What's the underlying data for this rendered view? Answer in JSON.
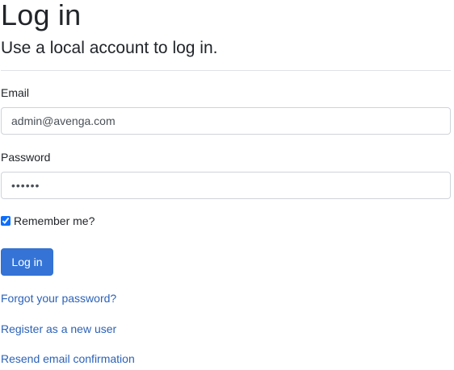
{
  "page": {
    "title": "Log in",
    "subtitle": "Use a local account to log in."
  },
  "form": {
    "email_label": "Email",
    "email_value": "admin@avenga.com",
    "password_label": "Password",
    "password_value": "••••••",
    "remember_label": "Remember me?",
    "remember_checked": true,
    "submit_label": "Log in"
  },
  "links": {
    "forgot_password": "Forgot your password?",
    "register": "Register as a new user",
    "resend_confirmation": "Resend email confirmation"
  },
  "colors": {
    "primary": "#3574d6",
    "link": "#2b62b8",
    "text": "#212529",
    "border": "#ced4da"
  }
}
